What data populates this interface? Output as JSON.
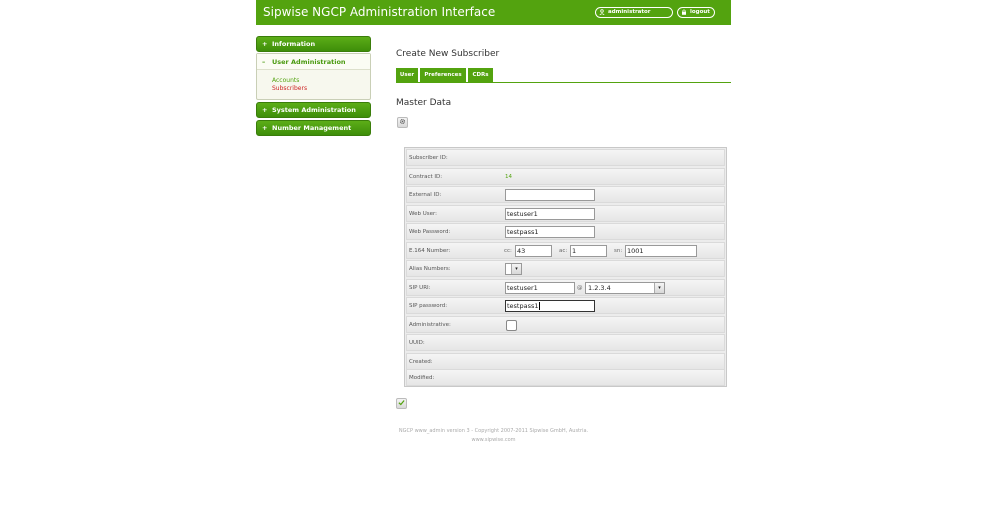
{
  "header": {
    "title": "Sipwise NGCP Administration Interface",
    "user_label": "administrator",
    "user_icon": "user-icon",
    "logout_label": "logout",
    "logout_icon": "lock-icon",
    "background": "#53a30f"
  },
  "sidebar": {
    "sections": [
      {
        "sign": "+",
        "label": "Information"
      },
      {
        "sign": "–",
        "label": "User Administration"
      },
      {
        "sign": "+",
        "label": "System Administration"
      },
      {
        "sign": "+",
        "label": "Number Management"
      }
    ],
    "user_admin_items": [
      "Accounts",
      "Subscribers"
    ]
  },
  "main": {
    "page_title": "Create New Subscriber",
    "tabs": [
      "User",
      "Preferences",
      "CDRs"
    ],
    "section_title": "Master Data",
    "settings_icon": "gear-icon",
    "submit_icon": "check-icon"
  },
  "form": {
    "subscriber_id": {
      "label": "Subscriber ID:"
    },
    "contract_id": {
      "label": "Contract ID:",
      "value": "14"
    },
    "external_id": {
      "label": "External ID:",
      "value": ""
    },
    "web_user": {
      "label": "Web User:",
      "value": "testuser1"
    },
    "web_password": {
      "label": "Web Password:",
      "value": "testpass1"
    },
    "e164": {
      "label": "E.164 Number:",
      "cc_label": "cc:",
      "cc_value": "43",
      "ac_label": "ac:",
      "ac_value": "1",
      "sn_label": "sn:",
      "sn_value": "1001"
    },
    "alias_numbers": {
      "label": "Alias Numbers:"
    },
    "sip_uri": {
      "label": "SIP URI:",
      "user_value": "testuser1",
      "at": "@",
      "domain_value": "1.2.3.4"
    },
    "sip_password": {
      "label": "SIP password:",
      "value": "testpass1"
    },
    "administrative": {
      "label": "Administrative:",
      "checked": false
    },
    "uuid": {
      "label": "UUID:"
    },
    "created": {
      "label": "Created:"
    },
    "modified": {
      "label": "Modified:"
    }
  },
  "footer": {
    "line1": "NGCP www_admin version 3 - Copyright 2007-2011 Sipwise GmbH, Austria.",
    "line2": "www.sipwise.com"
  }
}
